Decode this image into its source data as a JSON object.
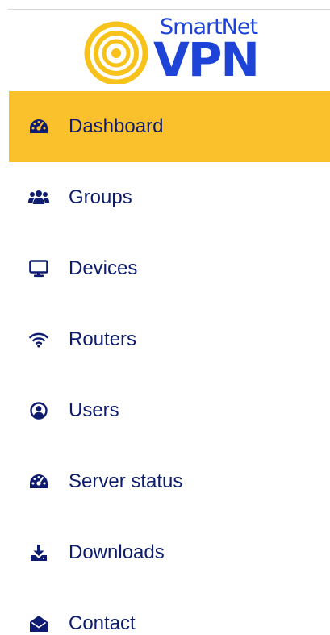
{
  "logo": {
    "line1": "SmartNet",
    "line2": "VPN"
  },
  "colors": {
    "accent": "#fbc12d",
    "nav_text": "#0d1c6e",
    "brand_blue": "#1d44d6"
  },
  "nav": {
    "items": [
      {
        "label": "Dashboard",
        "icon": "dashboard-gauge-icon",
        "active": true
      },
      {
        "label": "Groups",
        "icon": "users-group-icon",
        "active": false
      },
      {
        "label": "Devices",
        "icon": "monitor-icon",
        "active": false
      },
      {
        "label": "Routers",
        "icon": "wifi-icon",
        "active": false
      },
      {
        "label": "Users",
        "icon": "user-circle-icon",
        "active": false
      },
      {
        "label": "Server status",
        "icon": "server-status-gauge-icon",
        "active": false
      },
      {
        "label": "Downloads",
        "icon": "download-icon",
        "active": false
      },
      {
        "label": "Contact",
        "icon": "envelope-open-icon",
        "active": false
      }
    ]
  }
}
